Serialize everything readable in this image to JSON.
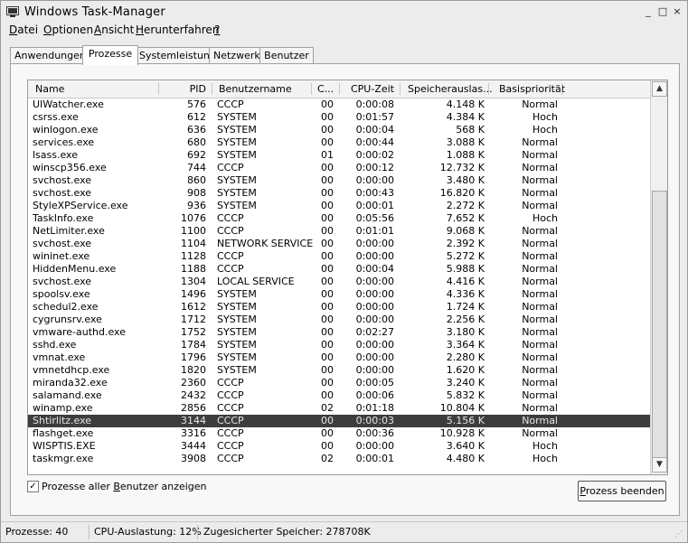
{
  "window": {
    "title": "Windows Task-Manager"
  },
  "titlebar_buttons": {
    "minimize": "_",
    "maximize": "□",
    "close": "×"
  },
  "menu": [
    {
      "pre": "",
      "u": "D",
      "post": "atei"
    },
    {
      "pre": "",
      "u": "O",
      "post": "ptionen"
    },
    {
      "pre": "",
      "u": "A",
      "post": "nsicht"
    },
    {
      "pre": "",
      "u": "H",
      "post": "erunterfahren"
    },
    {
      "pre": "",
      "u": "?",
      "post": ""
    }
  ],
  "tabs": [
    "Anwendungen",
    "Prozesse",
    "Systemleistung",
    "Netzwerk",
    "Benutzer"
  ],
  "active_tab": "Prozesse",
  "columns": {
    "name": "Name",
    "pid": "PID",
    "user": "Benutzername",
    "cpu": "C...",
    "time": "CPU-Zeit",
    "mem": "Speicherauslas...",
    "prio": "Basispriorität"
  },
  "processes": [
    {
      "name": "UIWatcher.exe",
      "pid": "576",
      "user": "CCCP",
      "cpu": "00",
      "time": "0:00:08",
      "mem": "4.148 K",
      "prio": "Normal"
    },
    {
      "name": "csrss.exe",
      "pid": "612",
      "user": "SYSTEM",
      "cpu": "00",
      "time": "0:01:57",
      "mem": "4.384 K",
      "prio": "Hoch"
    },
    {
      "name": "winlogon.exe",
      "pid": "636",
      "user": "SYSTEM",
      "cpu": "00",
      "time": "0:00:04",
      "mem": "568 K",
      "prio": "Hoch"
    },
    {
      "name": "services.exe",
      "pid": "680",
      "user": "SYSTEM",
      "cpu": "00",
      "time": "0:00:44",
      "mem": "3.088 K",
      "prio": "Normal"
    },
    {
      "name": "lsass.exe",
      "pid": "692",
      "user": "SYSTEM",
      "cpu": "01",
      "time": "0:00:02",
      "mem": "1.088 K",
      "prio": "Normal"
    },
    {
      "name": "winscp356.exe",
      "pid": "744",
      "user": "CCCP",
      "cpu": "00",
      "time": "0:00:12",
      "mem": "12.732 K",
      "prio": "Normal"
    },
    {
      "name": "svchost.exe",
      "pid": "860",
      "user": "SYSTEM",
      "cpu": "00",
      "time": "0:00:00",
      "mem": "3.480 K",
      "prio": "Normal"
    },
    {
      "name": "svchost.exe",
      "pid": "908",
      "user": "SYSTEM",
      "cpu": "00",
      "time": "0:00:43",
      "mem": "16.820 K",
      "prio": "Normal"
    },
    {
      "name": "StyleXPService.exe",
      "pid": "936",
      "user": "SYSTEM",
      "cpu": "00",
      "time": "0:00:01",
      "mem": "2.272 K",
      "prio": "Normal"
    },
    {
      "name": "TaskInfo.exe",
      "pid": "1076",
      "user": "CCCP",
      "cpu": "00",
      "time": "0:05:56",
      "mem": "7.652 K",
      "prio": "Hoch"
    },
    {
      "name": "NetLimiter.exe",
      "pid": "1100",
      "user": "CCCP",
      "cpu": "00",
      "time": "0:01:01",
      "mem": "9.068 K",
      "prio": "Normal"
    },
    {
      "name": "svchost.exe",
      "pid": "1104",
      "user": "NETWORK SERVICE",
      "cpu": "00",
      "time": "0:00:00",
      "mem": "2.392 K",
      "prio": "Normal"
    },
    {
      "name": "wininet.exe",
      "pid": "1128",
      "user": "CCCP",
      "cpu": "00",
      "time": "0:00:00",
      "mem": "5.272 K",
      "prio": "Normal"
    },
    {
      "name": "HiddenMenu.exe",
      "pid": "1188",
      "user": "CCCP",
      "cpu": "00",
      "time": "0:00:04",
      "mem": "5.988 K",
      "prio": "Normal"
    },
    {
      "name": "svchost.exe",
      "pid": "1304",
      "user": "LOCAL SERVICE",
      "cpu": "00",
      "time": "0:00:00",
      "mem": "4.416 K",
      "prio": "Normal"
    },
    {
      "name": "spoolsv.exe",
      "pid": "1496",
      "user": "SYSTEM",
      "cpu": "00",
      "time": "0:00:00",
      "mem": "4.336 K",
      "prio": "Normal"
    },
    {
      "name": "schedul2.exe",
      "pid": "1612",
      "user": "SYSTEM",
      "cpu": "00",
      "time": "0:00:00",
      "mem": "1.724 K",
      "prio": "Normal"
    },
    {
      "name": "cygrunsrv.exe",
      "pid": "1712",
      "user": "SYSTEM",
      "cpu": "00",
      "time": "0:00:00",
      "mem": "2.256 K",
      "prio": "Normal"
    },
    {
      "name": "vmware-authd.exe",
      "pid": "1752",
      "user": "SYSTEM",
      "cpu": "00",
      "time": "0:02:27",
      "mem": "3.180 K",
      "prio": "Normal"
    },
    {
      "name": "sshd.exe",
      "pid": "1784",
      "user": "SYSTEM",
      "cpu": "00",
      "time": "0:00:00",
      "mem": "3.364 K",
      "prio": "Normal"
    },
    {
      "name": "vmnat.exe",
      "pid": "1796",
      "user": "SYSTEM",
      "cpu": "00",
      "time": "0:00:00",
      "mem": "2.280 K",
      "prio": "Normal"
    },
    {
      "name": "vmnetdhcp.exe",
      "pid": "1820",
      "user": "SYSTEM",
      "cpu": "00",
      "time": "0:00:00",
      "mem": "1.620 K",
      "prio": "Normal"
    },
    {
      "name": "miranda32.exe",
      "pid": "2360",
      "user": "CCCP",
      "cpu": "00",
      "time": "0:00:05",
      "mem": "3.240 K",
      "prio": "Normal"
    },
    {
      "name": "salamand.exe",
      "pid": "2432",
      "user": "CCCP",
      "cpu": "00",
      "time": "0:00:06",
      "mem": "5.832 K",
      "prio": "Normal"
    },
    {
      "name": "winamp.exe",
      "pid": "2856",
      "user": "CCCP",
      "cpu": "02",
      "time": "0:01:18",
      "mem": "10.804 K",
      "prio": "Normal"
    },
    {
      "name": "Shtirlitz.exe",
      "pid": "3144",
      "user": "CCCP",
      "cpu": "00",
      "time": "0:00:03",
      "mem": "5.156 K",
      "prio": "Normal",
      "selected": true
    },
    {
      "name": "flashget.exe",
      "pid": "3316",
      "user": "CCCP",
      "cpu": "00",
      "time": "0:00:36",
      "mem": "10.928 K",
      "prio": "Normal"
    },
    {
      "name": "WISPTIS.EXE",
      "pid": "3444",
      "user": "CCCP",
      "cpu": "00",
      "time": "0:00:00",
      "mem": "3.640 K",
      "prio": "Hoch"
    },
    {
      "name": "taskmgr.exe",
      "pid": "3908",
      "user": "CCCP",
      "cpu": "02",
      "time": "0:00:01",
      "mem": "4.480 K",
      "prio": "Hoch"
    }
  ],
  "show_all_users": {
    "pre": "Prozesse aller ",
    "u": "B",
    "post": "enutzer anzeigen",
    "checked": true
  },
  "end_process": {
    "pre": "",
    "u": "P",
    "post": "rozess beenden"
  },
  "status": {
    "processes": "Prozesse: 40",
    "cpu": "CPU-Auslastung: 12%",
    "memory": "Zugesicherter Speicher: 278708K"
  },
  "colors": {
    "selection": "#3d3d3d",
    "selection_text": "#e6e6e6"
  }
}
